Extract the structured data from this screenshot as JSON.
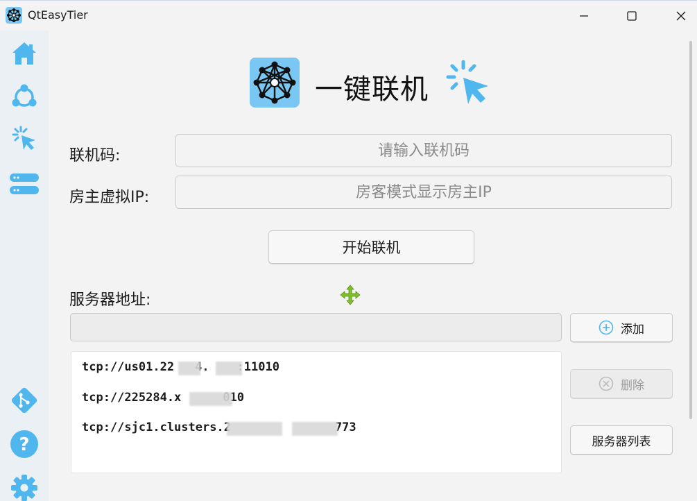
{
  "window": {
    "title": "QtEasyTier",
    "controls": {
      "minimize": "minimize",
      "maximize": "maximize",
      "close": "close"
    }
  },
  "sidebar": {
    "items": [
      {
        "name": "home",
        "icon": "home-icon"
      },
      {
        "name": "network",
        "icon": "network-group-icon"
      },
      {
        "name": "one-click",
        "icon": "click-cursor-icon"
      },
      {
        "name": "servers",
        "icon": "server-list-icon"
      },
      {
        "name": "git",
        "icon": "git-icon"
      },
      {
        "name": "help",
        "icon": "help-icon"
      },
      {
        "name": "settings",
        "icon": "gear-icon"
      }
    ]
  },
  "hero": {
    "title": "一键联机"
  },
  "form": {
    "code_label": "联机码:",
    "code_placeholder": "请输入联机码",
    "host_ip_label": "房主虚拟IP:",
    "host_ip_placeholder": "房客模式显示房主IP",
    "start_button": "开始联机"
  },
  "servers": {
    "label": "服务器地址:",
    "input_value": "",
    "add_button": "添加",
    "delete_button": "删除",
    "list_button": "服务器列表",
    "rows": [
      {
        "prefix": "tcp://us01.22",
        "suffix": "4.",
        "end": ":11010"
      },
      {
        "prefix": "tcp://225284.x",
        "end": "010"
      },
      {
        "prefix": "tcp://sjc1.clusters.2",
        "end": "773"
      }
    ]
  },
  "colors": {
    "accent": "#4fb6ee",
    "logo_bg": "#79c7f2",
    "sidebar_bg": "#eaf0f4",
    "move_icon": "#7fbf2a"
  }
}
